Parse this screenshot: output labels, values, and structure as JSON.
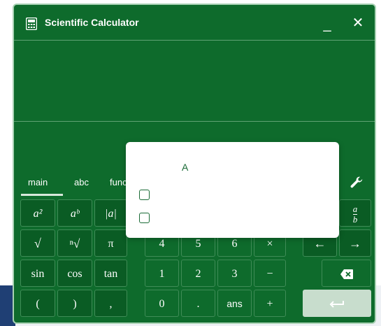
{
  "window": {
    "title": "Scientific Calculator",
    "minimize_label": "_",
    "close_label": "✕",
    "icon": "calculator-icon"
  },
  "tabs": [
    {
      "label": "main",
      "active": true
    },
    {
      "label": "abc",
      "active": false
    },
    {
      "label": "func",
      "active": false
    }
  ],
  "settings_icon": "wrench-icon",
  "keys": {
    "row1": {
      "a2": "a²",
      "ab": "aᵇ",
      "abs": "|a|",
      "frac_num": "a",
      "frac_den": "b"
    },
    "row2": {
      "sqrt": "√",
      "nthroot": "ⁿ√",
      "pi": "π",
      "d4": "4",
      "d5": "5",
      "d6": "6",
      "times": "×",
      "left": "←",
      "right": "→"
    },
    "row3": {
      "sin": "sin",
      "cos": "cos",
      "tan": "tan",
      "d1": "1",
      "d2": "2",
      "d3": "3",
      "minus": "−",
      "backspace": "⌫"
    },
    "row4": {
      "lparen": "(",
      "rparen": ")",
      "comma": ",",
      "d0": "0",
      "dot": ".",
      "ans": "ans",
      "plus": "+",
      "enter": "↵"
    }
  },
  "modal": {
    "label": "A",
    "checkboxes": [
      false,
      false
    ]
  },
  "colors": {
    "background": "#0e6b2c",
    "border": "#a9d2b4",
    "key_border": "#3f8c57",
    "enter_key": "#c8ddcd",
    "modal_text": "#1a6b36"
  }
}
